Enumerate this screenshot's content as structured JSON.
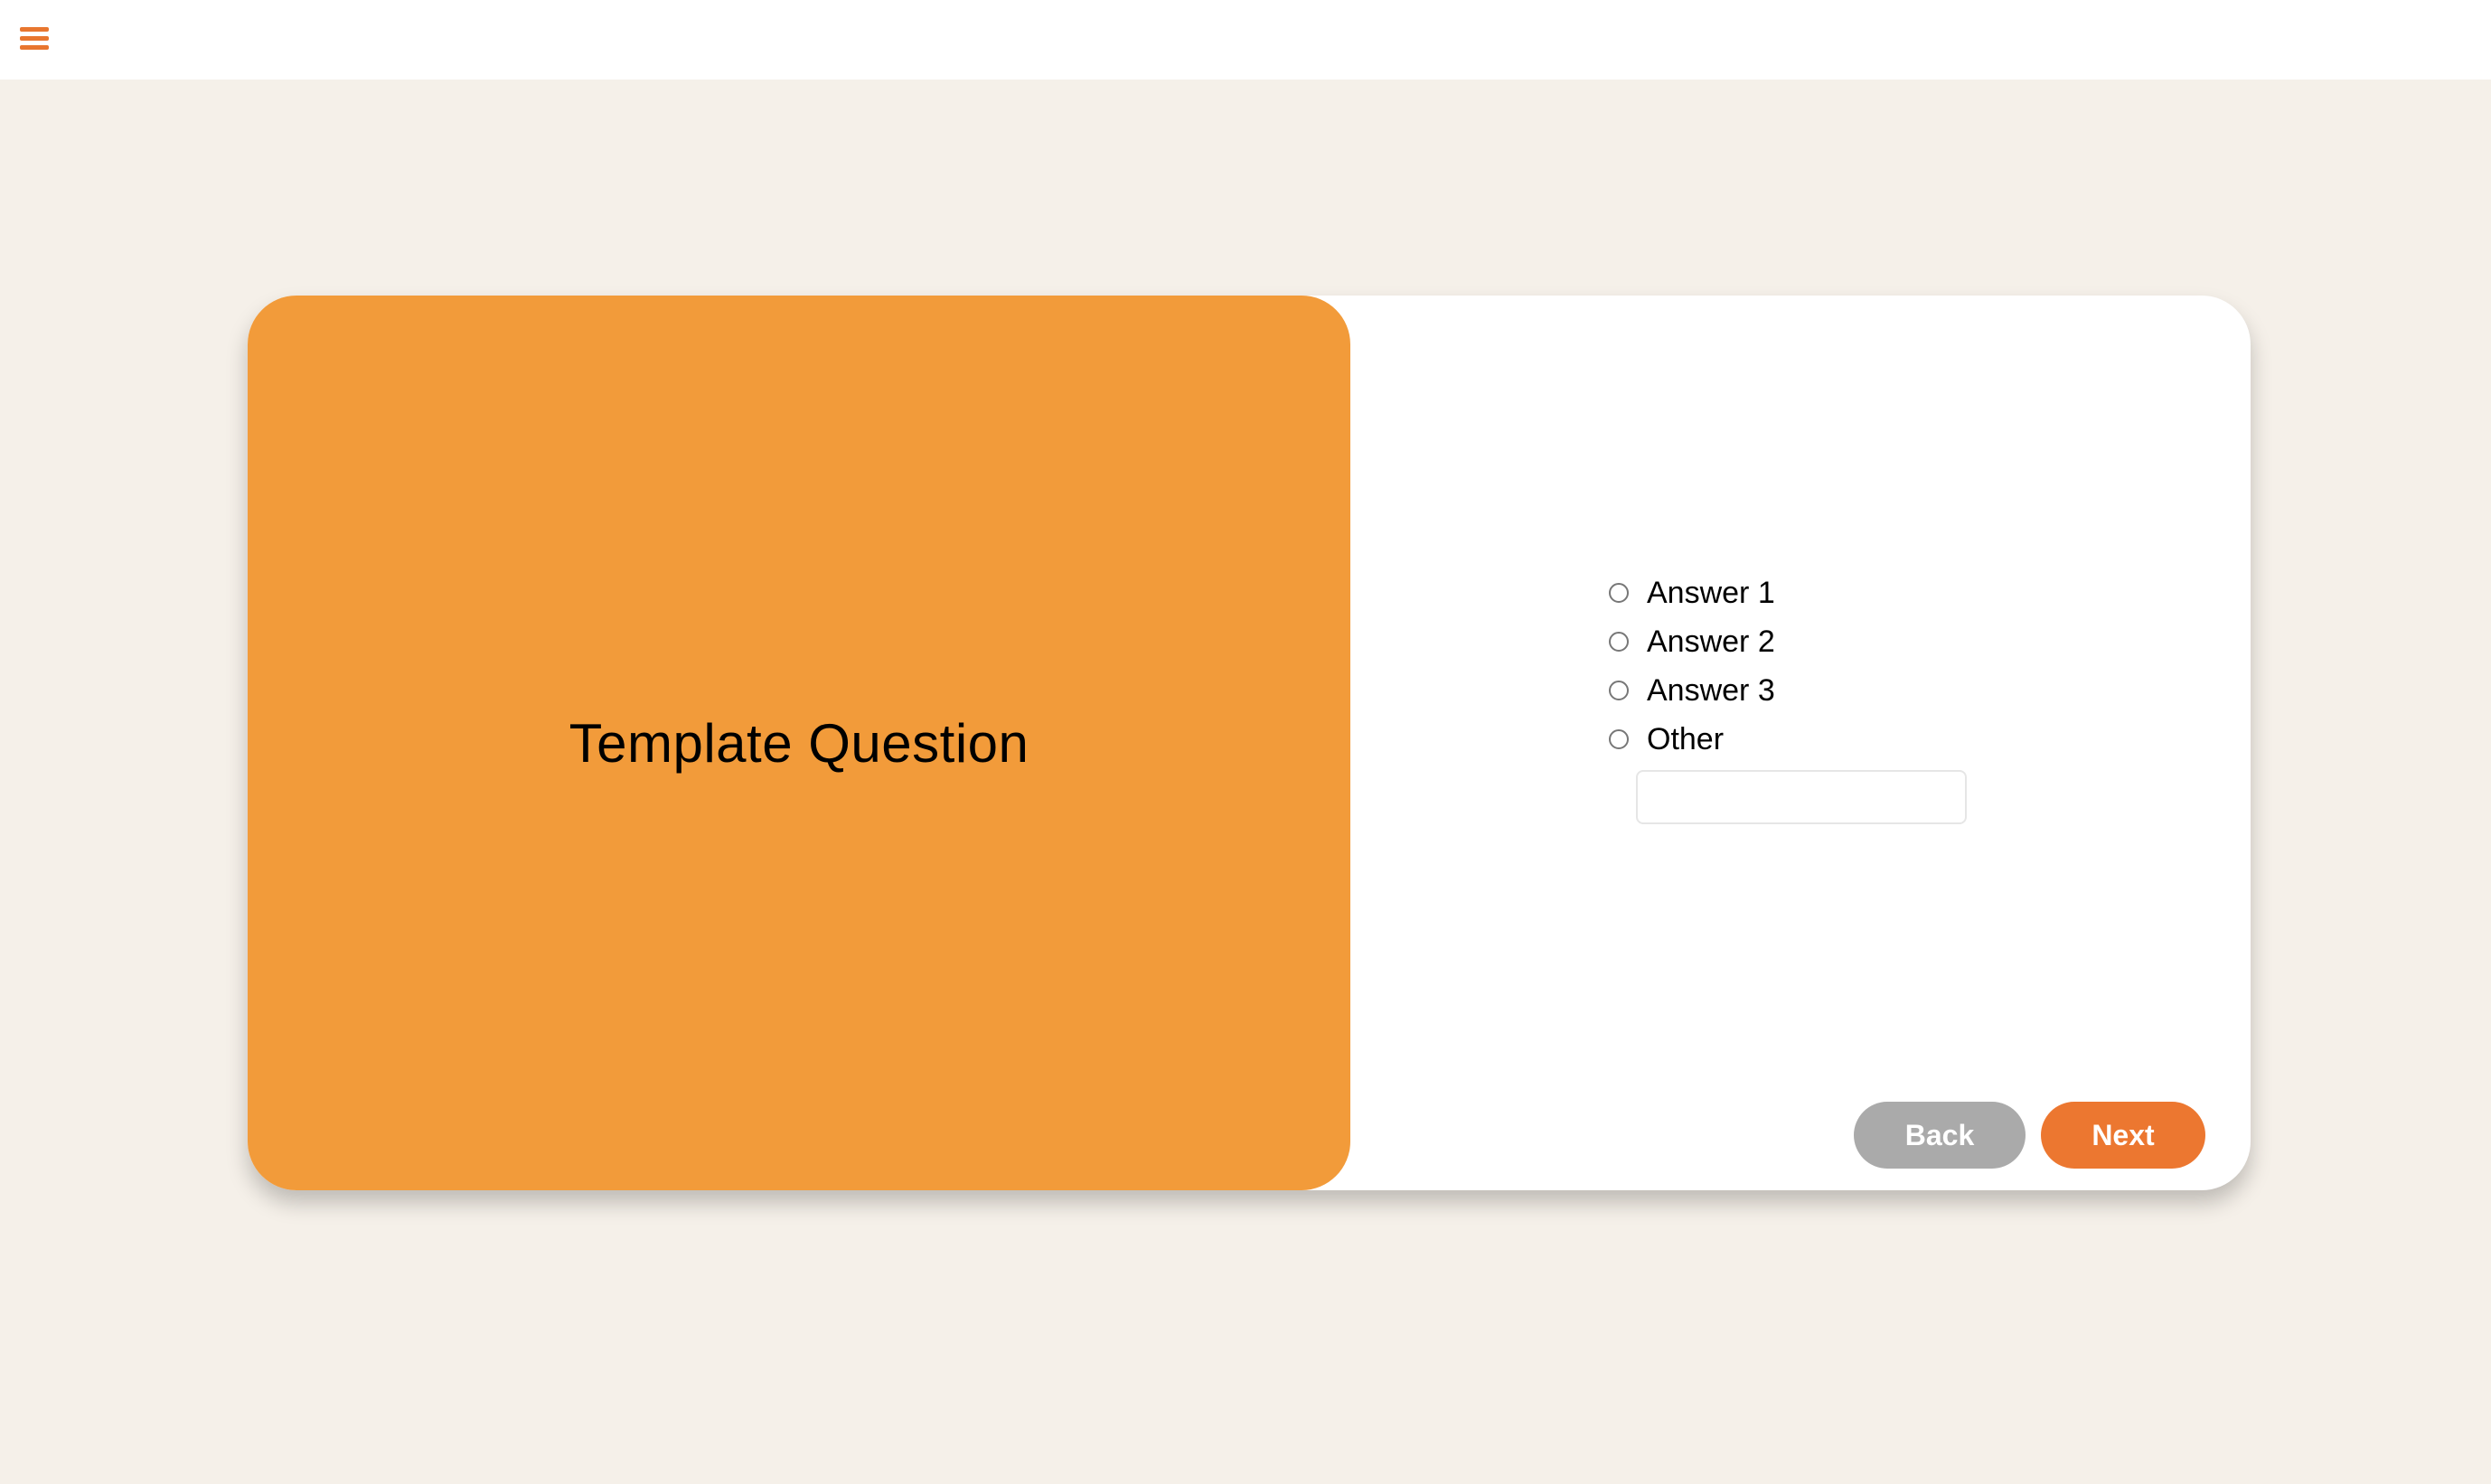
{
  "header": {
    "menu_icon": "hamburger-menu-icon"
  },
  "question": {
    "title": "Template Question"
  },
  "answers": {
    "options": [
      {
        "label": "Answer 1"
      },
      {
        "label": "Answer 2"
      },
      {
        "label": "Answer 3"
      },
      {
        "label": "Other"
      }
    ],
    "other_input_value": ""
  },
  "navigation": {
    "back_label": "Back",
    "next_label": "Next"
  },
  "colors": {
    "page_background": "#f5f0e9",
    "accent_orange": "#f29b3a",
    "menu_icon": "#e8762f",
    "next_button": "#ec7730",
    "back_button": "#aaaaaa"
  }
}
